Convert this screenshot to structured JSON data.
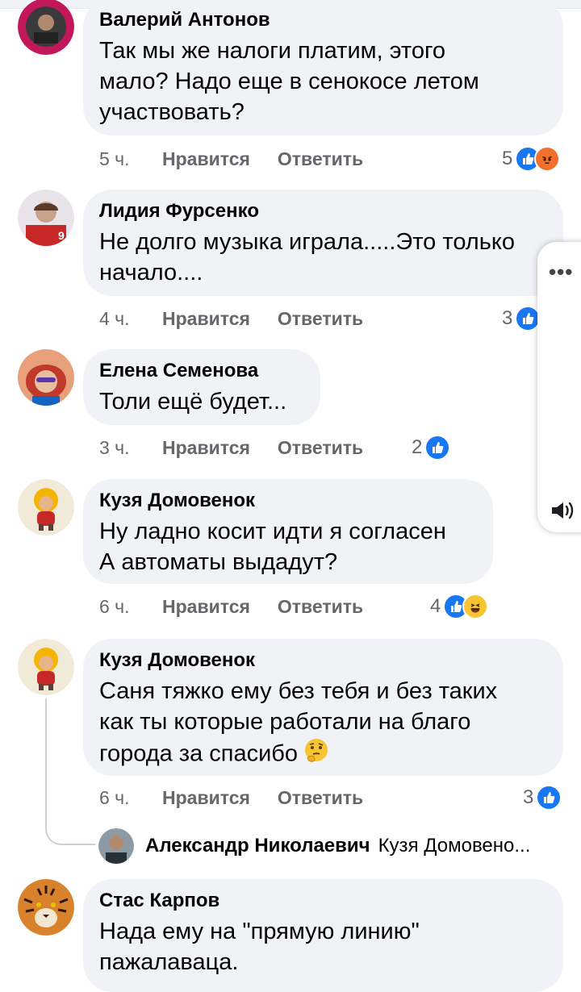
{
  "comments": [
    {
      "author": "Валерий Антонов",
      "lines": [
        "Так мы же налоги платим, этого",
        "мало? Надо еще в сенокосе летом",
        "участвовать?"
      ],
      "time": "5 ч.",
      "like_label": "Нравится",
      "reply_label": "Ответить",
      "reaction_count": "5",
      "reaction_icons": [
        "like-icon",
        "angry-icon"
      ]
    },
    {
      "author": "Лидия Фурсенко",
      "lines": [
        "Не долго музыка играла.....Это только",
        "начало...."
      ],
      "time": "4 ч.",
      "like_label": "Нравится",
      "reply_label": "Ответить",
      "reaction_count": "3",
      "reaction_icons": [
        "like-icon"
      ]
    },
    {
      "author": "Елена Семенова",
      "lines": [
        "Толи ещё будет..."
      ],
      "time": "3 ч.",
      "like_label": "Нравится",
      "reply_label": "Ответить",
      "reaction_count": "2",
      "reaction_icons": [
        "like-icon"
      ]
    },
    {
      "author": "Кузя Домовенок",
      "lines": [
        "Ну ладно косит идти я согласен",
        "А автоматы выдадут?"
      ],
      "time": "6 ч.",
      "like_label": "Нравится",
      "reply_label": "Ответить",
      "reaction_count": "4",
      "reaction_icons": [
        "like-icon",
        "haha-icon"
      ]
    },
    {
      "author": "Кузя Домовенок",
      "lines": [
        "Саня тяжко ему без тебя и без таких",
        "как ты которые работали на благо",
        "города за спасибо"
      ],
      "inline_emoji": "thinking-face-icon",
      "time": "6 ч.",
      "like_label": "Нравится",
      "reply_label": "Ответить",
      "reaction_count": "3",
      "reaction_icons": [
        "like-icon"
      ]
    },
    {
      "author": "Стас Карпов",
      "lines": [
        "Нада ему на \"прямую линию\"",
        "пажалаваца."
      ]
    }
  ],
  "reply_preview": {
    "author": "Александр Николаевич",
    "snippet": "Кузя Домовено..."
  },
  "side_panel": {
    "more_icon": "more-dots-icon",
    "audio_icon": "speaker-icon"
  },
  "colors": {
    "bubble_bg": "#f0f2f5",
    "meta_text": "#65676b",
    "like_blue": "#1877f2",
    "angry_orange": "#f3702a",
    "haha_yellow": "#f7c531"
  }
}
